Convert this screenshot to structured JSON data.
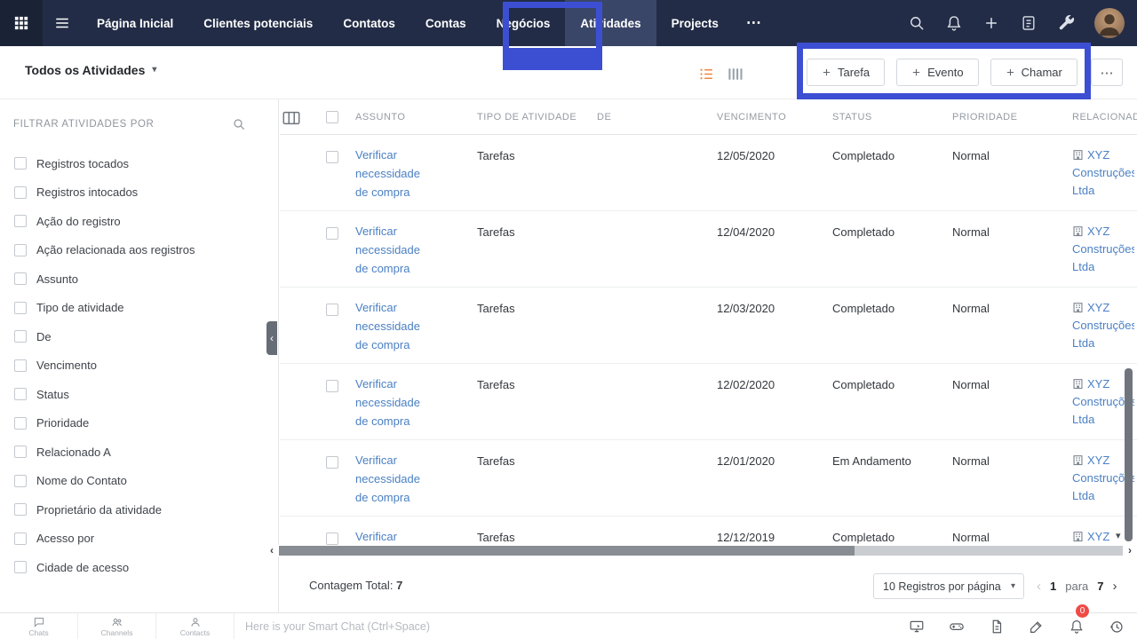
{
  "topnav": {
    "items": [
      "Página Inicial",
      "Clientes potenciais",
      "Contatos",
      "Contas",
      "Negócios",
      "Atividades",
      "Projects"
    ]
  },
  "toolbar": {
    "view_selector": "Todos os Atividades",
    "actions": [
      {
        "label": "Tarefa"
      },
      {
        "label": "Evento"
      },
      {
        "label": "Chamar"
      }
    ]
  },
  "sidebar": {
    "title": "FILTRAR ATIVIDADES POR",
    "filters": [
      "Registros tocados",
      "Registros intocados",
      "Ação do registro",
      "Ação relacionada aos registros",
      "Assunto",
      "Tipo de atividade",
      "De",
      "Vencimento",
      "Status",
      "Prioridade",
      "Relacionado A",
      "Nome do Contato",
      "Proprietário da atividade",
      "Acesso por",
      "Cidade de acesso"
    ]
  },
  "table": {
    "columns": [
      "ASSUNTO",
      "TIPO DE ATIVIDADE",
      "DE",
      "VENCIMENTO",
      "STATUS",
      "PRIORIDADE",
      "RELACIONADO A"
    ],
    "rows": [
      {
        "subject": "Verificar necessidade de compra",
        "type": "Tarefas",
        "from": "",
        "due": "12/05/2020",
        "status": "Completado",
        "priority": "Normal",
        "related": "XYZ Construções Ltda"
      },
      {
        "subject": "Verificar necessidade de compra",
        "type": "Tarefas",
        "from": "",
        "due": "12/04/2020",
        "status": "Completado",
        "priority": "Normal",
        "related": "XYZ Construções Ltda"
      },
      {
        "subject": "Verificar necessidade de compra",
        "type": "Tarefas",
        "from": "",
        "due": "12/03/2020",
        "status": "Completado",
        "priority": "Normal",
        "related": "XYZ Construções Ltda"
      },
      {
        "subject": "Verificar necessidade de compra",
        "type": "Tarefas",
        "from": "",
        "due": "12/02/2020",
        "status": "Completado",
        "priority": "Normal",
        "related": "XYZ Construções Ltda"
      },
      {
        "subject": "Verificar necessidade de compra",
        "type": "Tarefas",
        "from": "",
        "due": "12/01/2020",
        "status": "Em Andamento",
        "priority": "Normal",
        "related": "XYZ Construções Ltda"
      },
      {
        "subject": "Verificar necessidade de compra",
        "type": "Tarefas",
        "from": "",
        "due": "12/12/2019",
        "status": "Completado",
        "priority": "Normal",
        "related": "XYZ Construções Ltda"
      }
    ]
  },
  "footer": {
    "count_label": "Contagem Total:",
    "count_value": "7",
    "per_page_label": "10 Registros por página",
    "page_start": "1",
    "page_separator": "para",
    "page_end": "7"
  },
  "chatbar": {
    "items": [
      "Chats",
      "Channels",
      "Contacts"
    ],
    "placeholder": "Here is your Smart Chat (Ctrl+Space)",
    "badge": "0"
  },
  "icons": {
    "caret_down": "▾",
    "chevron_left": "‹",
    "chevron_right": "›",
    "more": "⋯"
  }
}
